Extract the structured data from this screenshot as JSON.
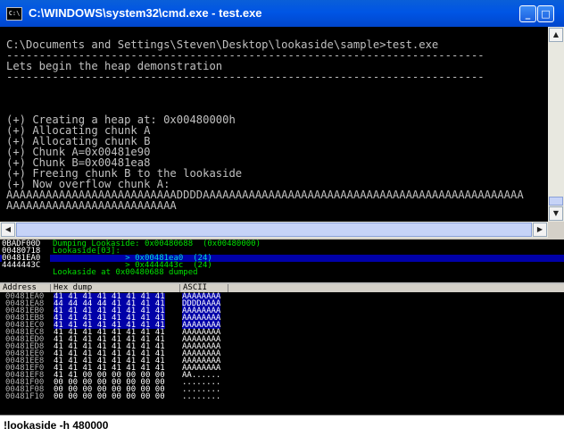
{
  "window": {
    "title": "C:\\WINDOWS\\system32\\cmd.exe - test.exe",
    "icon_label": "C:\\",
    "minimize_glyph": "_",
    "maximize_glyph": "□"
  },
  "console": {
    "lines": [
      "C:\\Documents and Settings\\Steven\\Desktop\\lookaside\\sample>test.exe",
      "-------------------------------------------------------------------------",
      "Lets begin the heap demonstration",
      "-------------------------------------------------------------------------",
      "",
      "",
      "",
      "(+) Creating a heap at: 0x00480000h",
      "(+) Allocating chunk A",
      "(+) Allocating chunk B",
      "(+) Chunk A=0x00481e90",
      "(+) Chunk B=0x00481ea8",
      "(+) Freeing chunk B to the lookaside",
      "(+) Now overflow chunk A:",
      "AAAAAAAAAAAAAAAAAAAAAAAAAADDDDAAAAAAAAAAAAAAAAAAAAAAAAAAAAAAAAAAAAAAAAAAAAAAAAA",
      "AAAAAAAAAAAAAAAAAAAAAAAAAA"
    ],
    "scroll_up_glyph": "▲",
    "scroll_down_glyph": "▼",
    "scroll_left_glyph": "◀",
    "scroll_right_glyph": "▶"
  },
  "log": {
    "rows": [
      {
        "addr": "0BADF00D",
        "msg": "Dumping Lookaside: 0x00480688  (0x00480000)",
        "color": "green",
        "highlight": false
      },
      {
        "addr": "00480718",
        "msg": "Lookaside[03]:",
        "color": "green",
        "highlight": false
      },
      {
        "addr": "00481EA0",
        "msg": "               > 0x00481ea0  (24)",
        "color": "cyan",
        "highlight": true
      },
      {
        "addr": "4444443C",
        "msg": "               > 0x4444443c  (24)",
        "color": "green",
        "highlight": false
      },
      {
        "addr": "",
        "msg": "Lookaside at 0x00480688 dumped",
        "color": "green",
        "highlight": false
      }
    ]
  },
  "dump": {
    "headers": [
      "Address",
      "Hex dump",
      "ASCII"
    ],
    "rows": [
      {
        "addr": "00481EA0",
        "hex": "41 41 41 41 41 41 41 41",
        "ascii": "AAAAAAAA",
        "selected": true
      },
      {
        "addr": "00481EA8",
        "hex": "44 44 44 44 41 41 41 41",
        "ascii": "DDDDAAAA",
        "selected": true
      },
      {
        "addr": "00481EB0",
        "hex": "41 41 41 41 41 41 41 41",
        "ascii": "AAAAAAAA",
        "selected": true
      },
      {
        "addr": "00481EB8",
        "hex": "41 41 41 41 41 41 41 41",
        "ascii": "AAAAAAAA",
        "selected": true
      },
      {
        "addr": "00481EC0",
        "hex": "41 41 41 41 41 41 41 41",
        "ascii": "AAAAAAAA",
        "selected": true
      },
      {
        "addr": "00481EC8",
        "hex": "41 41 41 41 41 41 41 41",
        "ascii": "AAAAAAAA",
        "selected": false
      },
      {
        "addr": "00481ED0",
        "hex": "41 41 41 41 41 41 41 41",
        "ascii": "AAAAAAAA",
        "selected": false
      },
      {
        "addr": "00481ED8",
        "hex": "41 41 41 41 41 41 41 41",
        "ascii": "AAAAAAAA",
        "selected": false
      },
      {
        "addr": "00481EE0",
        "hex": "41 41 41 41 41 41 41 41",
        "ascii": "AAAAAAAA",
        "selected": false
      },
      {
        "addr": "00481EE8",
        "hex": "41 41 41 41 41 41 41 41",
        "ascii": "AAAAAAAA",
        "selected": false
      },
      {
        "addr": "00481EF0",
        "hex": "41 41 41 41 41 41 41 41",
        "ascii": "AAAAAAAA",
        "selected": false
      },
      {
        "addr": "00481EF8",
        "hex": "41 41 00 00 00 00 00 00",
        "ascii": "AA......",
        "selected": false
      },
      {
        "addr": "00481F00",
        "hex": "00 00 00 00 00 00 00 00",
        "ascii": "........",
        "selected": false
      },
      {
        "addr": "00481F08",
        "hex": "00 00 00 00 00 00 00 00",
        "ascii": "........",
        "selected": false
      },
      {
        "addr": "00481F10",
        "hex": "00 00 00 00 00 00 00 00",
        "ascii": "........",
        "selected": false
      }
    ]
  },
  "command": {
    "value": "!lookaside -h 480000"
  },
  "colors": {
    "title_bar": "#0055e5",
    "console_bg": "#000000",
    "console_fg": "#c0c0c0",
    "log_green": "#00e000",
    "log_cyan": "#00d8d8",
    "selection": "#0000a8"
  }
}
